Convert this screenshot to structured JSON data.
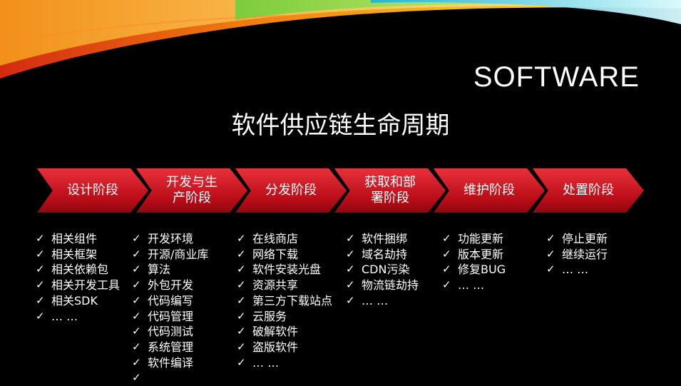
{
  "brand": "SOFTWARE",
  "title": "软件供应链生命周期",
  "colors": {
    "chevron": "#c8111c",
    "background": "#000000"
  },
  "stages": [
    {
      "label": "设计阶段",
      "items": [
        "相关组件",
        "相关框架",
        "相关依赖包",
        "相关开发工具",
        "相关SDK",
        "… …"
      ]
    },
    {
      "label": "开发与生产阶段",
      "items": [
        "开发环境",
        "开源/商业库",
        "算法",
        "外包开发",
        "代码编写",
        "代码管理",
        "代码测试",
        "系统管理",
        "软件编译",
        ""
      ]
    },
    {
      "label": "分发阶段",
      "items": [
        "在线商店",
        "网络下载",
        "软件安装光盘",
        "资源共享",
        "第三方下载站点",
        "云服务",
        "破解软件",
        "盗版软件",
        "… …"
      ]
    },
    {
      "label": "获取和部署阶段",
      "items": [
        "软件捆绑",
        "域名劫持",
        "CDN污染",
        "物流链劫持",
        "… …"
      ]
    },
    {
      "label": "维护阶段",
      "items": [
        "功能更新",
        "版本更新",
        "修复BUG",
        "… …"
      ]
    },
    {
      "label": "处置阶段",
      "items": [
        "停止更新",
        "继续运行",
        "… …"
      ]
    }
  ]
}
